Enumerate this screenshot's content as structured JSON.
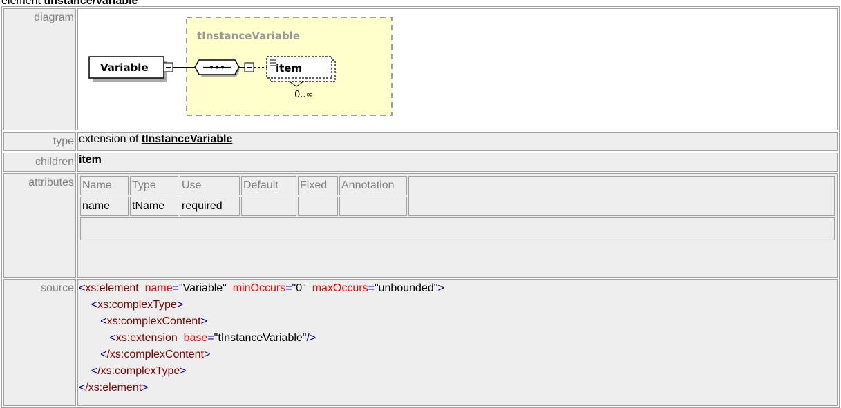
{
  "heading": {
    "prefix": "element",
    "name": "tInstance/Variable"
  },
  "rows": {
    "diagram_label": "diagram",
    "type_label": "type",
    "children_label": "children",
    "attributes_label": "attributes",
    "source_label": "source"
  },
  "diagram": {
    "group_title": "tInstanceVariable",
    "element_name": "Variable",
    "child_name": "item",
    "occurrence": "0..∞"
  },
  "type": {
    "prefix": "extension of",
    "link": "tInstanceVariable"
  },
  "children": {
    "link": "item"
  },
  "attributes": {
    "headers": [
      "Name",
      "Type",
      "Use",
      "Default",
      "Fixed",
      "Annotation"
    ],
    "rows": [
      [
        "name",
        "tName",
        "required",
        "",
        "",
        ""
      ]
    ]
  },
  "source": {
    "l1_tag": "xs:element",
    "l1_a1": "name",
    "l1_v1": "\"Variable\"",
    "l1_a2": "minOccurs",
    "l1_v2": "\"0\"",
    "l1_a3": "maxOccurs",
    "l1_v3": "\"unbounded\"",
    "l2_tag": "xs:complexType",
    "l3_tag": "xs:complexContent",
    "l4_tag": "xs:extension",
    "l4_a1": "base",
    "l4_v1": "\"tInstanceVariable\"",
    "l5_tag": "/xs:complexContent",
    "l6_tag": "/xs:complexType",
    "l7_tag": "/xs:element"
  }
}
